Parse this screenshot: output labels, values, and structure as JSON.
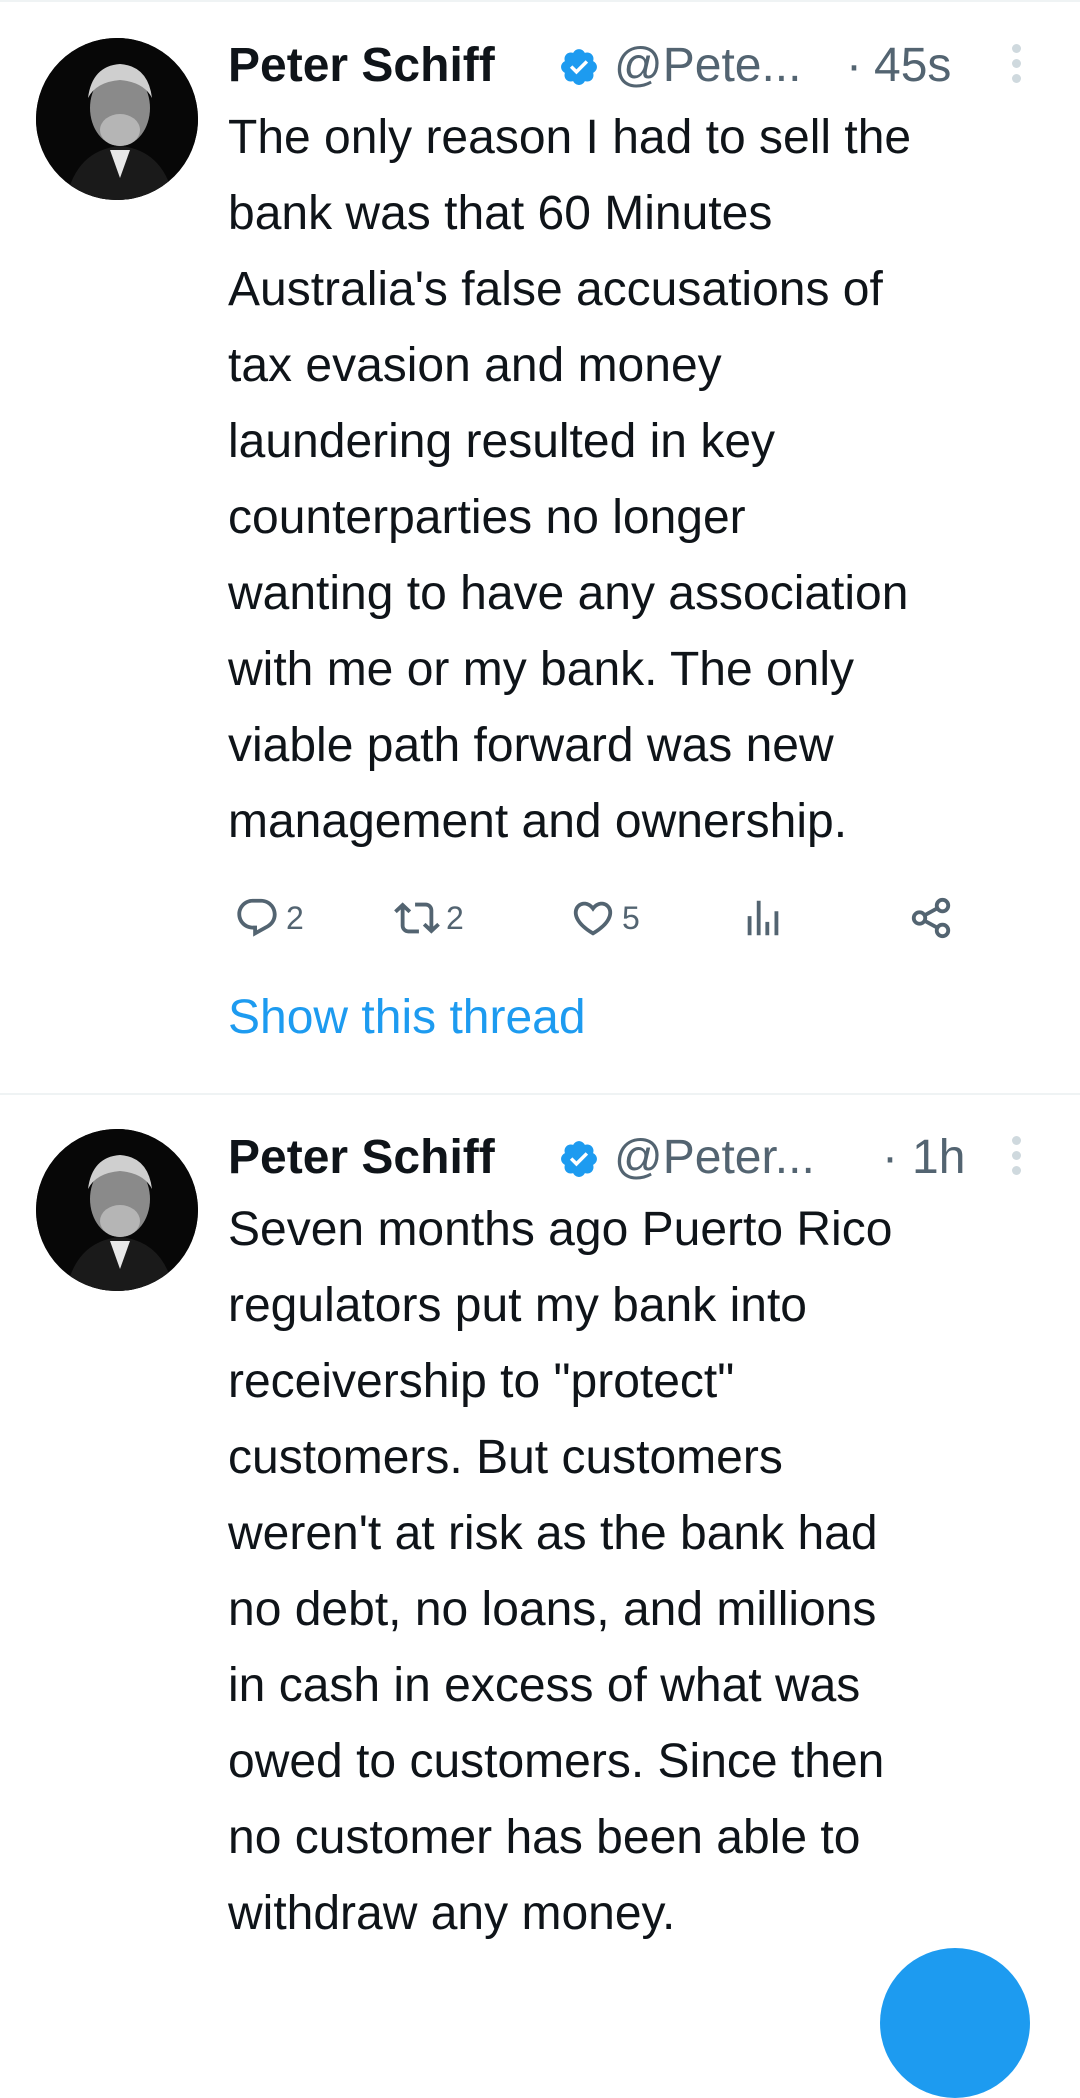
{
  "tweets": [
    {
      "author_name": "Peter Schiff",
      "handle": "@Pete...",
      "separator": "·",
      "time": "45s",
      "text": "The only reason I had to sell the\nbank was that 60 Minutes\nAustralia's false accusations of\ntax evasion and money\nlaundering resulted in key\ncounterparties no longer\nwanting to have any association\nwith me or my bank. The only\nviable path forward was new\nmanagement and ownership.",
      "stats": {
        "replies": "2",
        "retweets": "2",
        "likes": "5"
      },
      "show_thread": "Show this thread"
    },
    {
      "author_name": "Peter Schiff",
      "handle": "@Peter...",
      "separator": "·",
      "time": "1h",
      "text": "Seven months ago Puerto Rico\nregulators put my bank into\nreceivership to \"protect\"\ncustomers. But customers\nweren't at risk as the bank had\nno debt, no loans, and millions\nin cash in excess of what was\nowed to customers. Since then\nno customer has been able to\nwithdraw any money."
    }
  ],
  "icons": {
    "verified": "verified-badge-icon",
    "reply": "reply-icon",
    "retweet": "retweet-icon",
    "like": "heart-icon",
    "views": "views-icon",
    "share": "share-icon",
    "more": "more-options-icon"
  },
  "colors": {
    "accent": "#1d9bf0",
    "text": "#0f1419",
    "muted": "#536471",
    "divider": "#eff3f4"
  }
}
